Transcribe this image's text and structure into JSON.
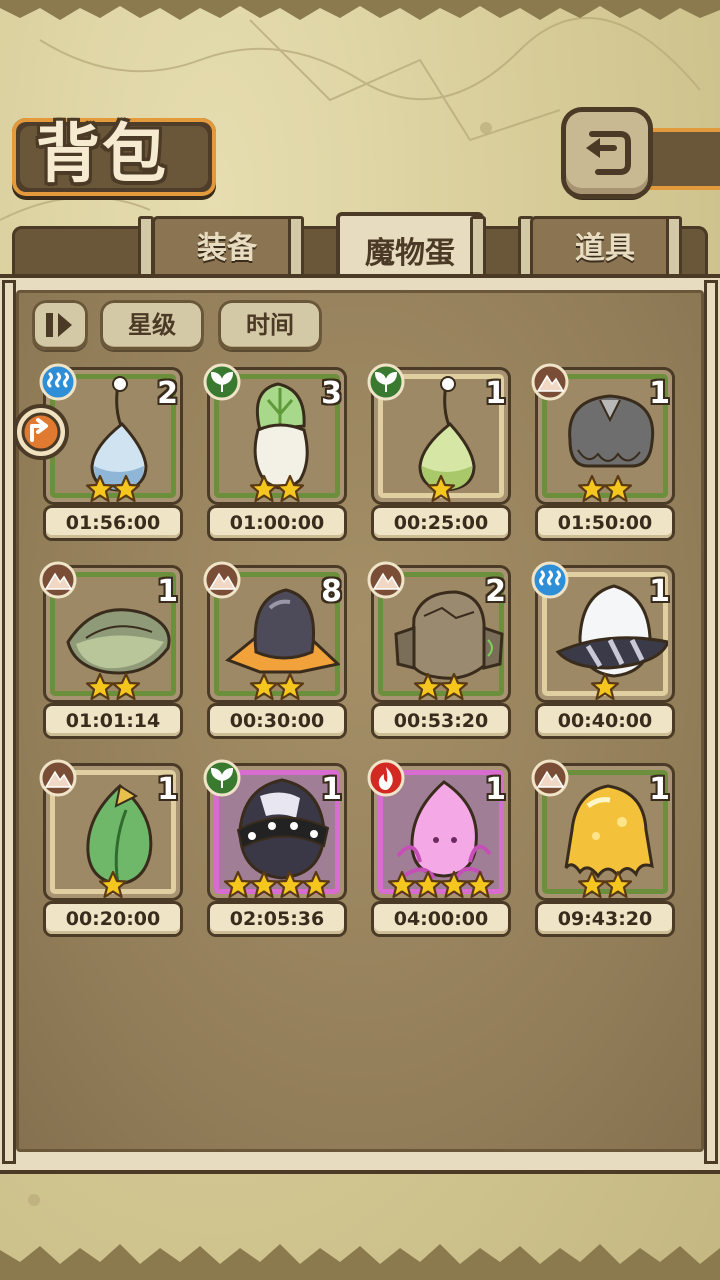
{
  "header": {
    "title": "背包",
    "back_icon": "return-arrow-icon"
  },
  "tabs": [
    {
      "label": "装备",
      "active": false
    },
    {
      "label": "魔物蛋",
      "active": true
    },
    {
      "label": "道具",
      "active": false
    }
  ],
  "sort": {
    "toggle_icon": "sort-toggle-icon",
    "star_label": "星级",
    "time_label": "时间"
  },
  "side_badge_icon": "orange-arrow-badge-icon",
  "colors": {
    "water": "#2f8fd6",
    "grass": "#3a7a30",
    "earth": "#7a4e36",
    "fire": "#d22a22",
    "rim_green": "#6b8f3a",
    "rim_tan": "#e0cfa0",
    "rim_pink": "#d86cd0",
    "star": "#f5c61e"
  },
  "eggs": [
    {
      "count": "2",
      "element": "water",
      "stars": 2,
      "rim": "green",
      "time": "01:56:00",
      "art": "blue-teardrop-egg"
    },
    {
      "count": "3",
      "element": "grass",
      "stars": 2,
      "rim": "green",
      "time": "01:00:00",
      "art": "turnip-egg"
    },
    {
      "count": "1",
      "element": "grass",
      "stars": 1,
      "rim": "tan",
      "time": "00:25:00",
      "art": "green-teardrop-egg"
    },
    {
      "count": "1",
      "element": "earth",
      "stars": 2,
      "rim": "green",
      "time": "01:50:00",
      "art": "furry-grey-egg"
    },
    {
      "count": "1",
      "element": "earth",
      "stars": 2,
      "rim": "green",
      "time": "01:01:14",
      "art": "seed-pod-egg"
    },
    {
      "count": "8",
      "element": "earth",
      "stars": 2,
      "rim": "green",
      "time": "00:30:00",
      "art": "hat-egg"
    },
    {
      "count": "2",
      "element": "earth",
      "stars": 2,
      "rim": "green",
      "time": "00:53:20",
      "art": "rock-golem-egg"
    },
    {
      "count": "1",
      "element": "water",
      "stars": 1,
      "rim": "tan",
      "time": "00:40:00",
      "art": "white-scarf-egg"
    },
    {
      "count": "1",
      "element": "earth",
      "stars": 1,
      "rim": "tan",
      "time": "00:20:00",
      "art": "leaf-bud-egg"
    },
    {
      "count": "1",
      "element": "grass",
      "stars": 4,
      "rim": "pink",
      "time": "02:05:36",
      "art": "spiked-collar-egg"
    },
    {
      "count": "1",
      "element": "fire",
      "stars": 4,
      "rim": "pink",
      "time": "04:00:00",
      "art": "pink-flame-egg"
    },
    {
      "count": "1",
      "element": "earth",
      "stars": 2,
      "rim": "green",
      "time": "09:43:20",
      "art": "golden-slime-egg"
    }
  ]
}
